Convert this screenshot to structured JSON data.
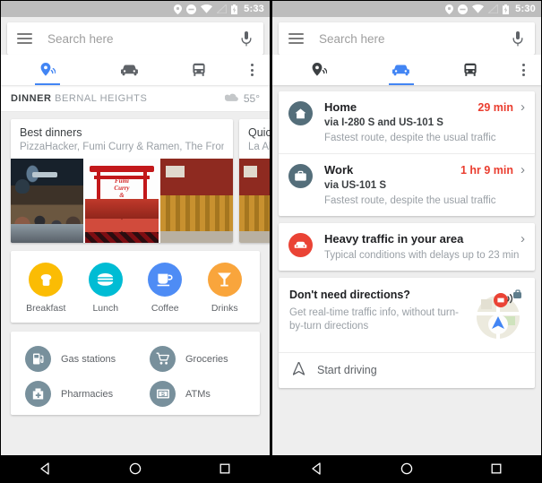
{
  "left": {
    "status": {
      "time": "5:33",
      "icons": [
        "location-pin",
        "do-not-disturb",
        "wifi",
        "signal-off",
        "battery"
      ]
    },
    "search": {
      "placeholder": "Search here",
      "value": "",
      "menu_icon": "hamburger-icon",
      "mic_icon": "microphone-icon"
    },
    "tabs": [
      {
        "name": "explore",
        "icon": "explore-pin-icon",
        "active": true
      },
      {
        "name": "driving",
        "icon": "car-icon",
        "active": false
      },
      {
        "name": "transit",
        "icon": "transit-bus-icon",
        "active": false
      }
    ],
    "overflow_label": "more-options",
    "header": {
      "meal": "DINNER",
      "area": "BERNAL HEIGHTS",
      "weather_icon": "cloud-icon",
      "temperature": "55°"
    },
    "cards": [
      {
        "title": "Best dinners",
        "subtitle": "PizzaHacker, Fumi Curry & Ramen, The Front…",
        "photos": [
          "restaurant-interior-photo",
          "fumi-curry-ramen-sign-photo",
          "dining-room-photo"
        ]
      },
      {
        "title": "Quick",
        "subtitle": "La Alt"
      }
    ],
    "quick_categories": [
      {
        "label": "Breakfast",
        "icon": "bread-icon",
        "color": "#fbbc04"
      },
      {
        "label": "Lunch",
        "icon": "burger-icon",
        "color": "#00bcd4"
      },
      {
        "label": "Coffee",
        "icon": "coffee-cup-icon",
        "color": "#4e8cf5"
      },
      {
        "label": "Drinks",
        "icon": "cocktail-icon",
        "color": "#f9a53c"
      }
    ],
    "services": [
      {
        "label": "Gas stations",
        "icon": "fuel-pump-icon"
      },
      {
        "label": "Groceries",
        "icon": "shopping-cart-icon"
      },
      {
        "label": "Pharmacies",
        "icon": "pharmacy-cross-icon"
      },
      {
        "label": "ATMs",
        "icon": "cash-note-icon"
      }
    ]
  },
  "right": {
    "status": {
      "time": "5:30"
    },
    "search": {
      "placeholder": "Search here",
      "value": ""
    },
    "tabs": [
      {
        "name": "explore",
        "icon": "explore-pin-icon",
        "active": false
      },
      {
        "name": "driving",
        "icon": "car-icon",
        "active": true
      },
      {
        "name": "transit",
        "icon": "transit-bus-icon",
        "active": false
      }
    ],
    "destinations": [
      {
        "name": "Home",
        "time": "29 min",
        "via": "via I-280 S and US-101 S",
        "note": "Fastest route, despite the usual traffic",
        "icon": "home-icon"
      },
      {
        "name": "Work",
        "time": "1 hr 9 min",
        "via": "via US-101 S",
        "note": "Fastest route, despite the usual traffic",
        "icon": "briefcase-icon"
      }
    ],
    "alert": {
      "title": "Heavy traffic in your area",
      "note": "Typical conditions with delays up to 23 min",
      "icon": "traffic-alert-icon"
    },
    "promo": {
      "title": "Don't need directions?",
      "subtitle": "Get real-time traffic info, without turn-by-turn directions",
      "art": "driving-mode-map-illustration",
      "cta_label": "Start driving",
      "cta_icon": "navigation-arrow-icon"
    }
  },
  "navbar": {
    "back": "back-icon",
    "home": "home-circle-icon",
    "recents": "recents-square-icon"
  },
  "colors": {
    "accent": "#4285f4",
    "alert_red": "#ea4335",
    "time_red": "#ea3d2f",
    "status_bar": "#bdbdbd"
  }
}
